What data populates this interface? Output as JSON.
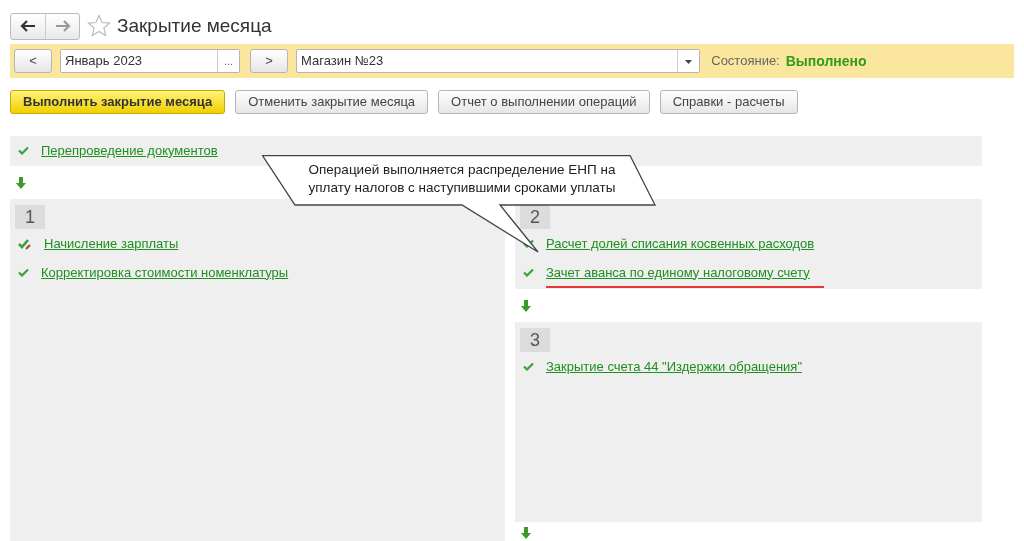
{
  "window": {
    "title": "Закрытие месяца",
    "favorite": false
  },
  "filter": {
    "period": "Январь 2023",
    "prev": "<",
    "next": ">",
    "period_button": "...",
    "organization": "Магазин №23",
    "state_label": "Состояние:",
    "state_value": "Выполнено"
  },
  "actions": [
    {
      "label": "Выполнить закрытие месяца",
      "kind": "primary"
    },
    {
      "label": "Отменить закрытие месяца",
      "kind": "normal"
    },
    {
      "label": "Отчет о выполнении операций",
      "kind": "normal"
    },
    {
      "label": "Справки - расчеты",
      "kind": "normal"
    }
  ],
  "preliminary": {
    "operations": [
      {
        "label": "Перепроведение документов",
        "done": true,
        "edited": false,
        "highlighted": false
      }
    ]
  },
  "left_stages": [
    {
      "number": "1",
      "operations": [
        {
          "label": "Начисление зарплаты",
          "done": true,
          "edited": true,
          "highlighted": false
        },
        {
          "label": "Корректировка стоимости номенклатуры",
          "done": true,
          "edited": false,
          "highlighted": false
        }
      ]
    }
  ],
  "right_stages": [
    {
      "number": "2",
      "operations": [
        {
          "label": "Расчет долей списания косвенных расходов",
          "done": true,
          "edited": false,
          "highlighted": false
        },
        {
          "label": "Зачет аванса по единому налоговому счету",
          "done": true,
          "edited": false,
          "highlighted": true
        }
      ]
    },
    {
      "number": "3",
      "operations": [
        {
          "label": "Закрытие счета 44 \"Издержки обращения\"",
          "done": true,
          "edited": false,
          "highlighted": false
        }
      ]
    }
  ],
  "callout": {
    "text": "Операцией выполняется распределение ЕНП на уплату налогов с наступившими сроками уплаты"
  }
}
